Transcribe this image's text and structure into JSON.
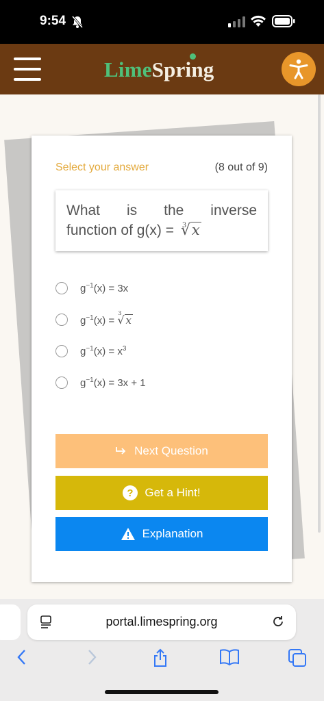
{
  "status_bar": {
    "time": "9:54"
  },
  "header": {
    "logo_lime": "Lime",
    "logo_spring": "Spring"
  },
  "quiz": {
    "select_label": "Select your answer",
    "progress": "(8 out of 9)",
    "question": {
      "words": [
        "What",
        "is",
        "the",
        "inverse"
      ],
      "line2": "function of g(x) =",
      "root_index": "3",
      "root_arg": "x"
    },
    "options": [
      {
        "prefix": "g",
        "sup": "−1",
        "rest": "(x) = 3x"
      },
      {
        "prefix": "g",
        "sup": "−1",
        "rest": "(x) =",
        "root_index": "3",
        "root_arg": "x"
      },
      {
        "prefix": "g",
        "sup": "−1",
        "rest": "(x) = x",
        "power": "3"
      },
      {
        "prefix": "g",
        "sup": "−1",
        "rest": "(x) = 3x + 1"
      }
    ],
    "buttons": {
      "next": "Next Question",
      "hint": "Get a Hint!",
      "explanation": "Explanation"
    },
    "colors": {
      "next": "#fdc07a",
      "hint": "#d6b80a",
      "explanation": "#0b87f0",
      "header": "#6b3a12",
      "accent": "#e8962a"
    }
  },
  "browser": {
    "url": "portal.limespring.org"
  }
}
